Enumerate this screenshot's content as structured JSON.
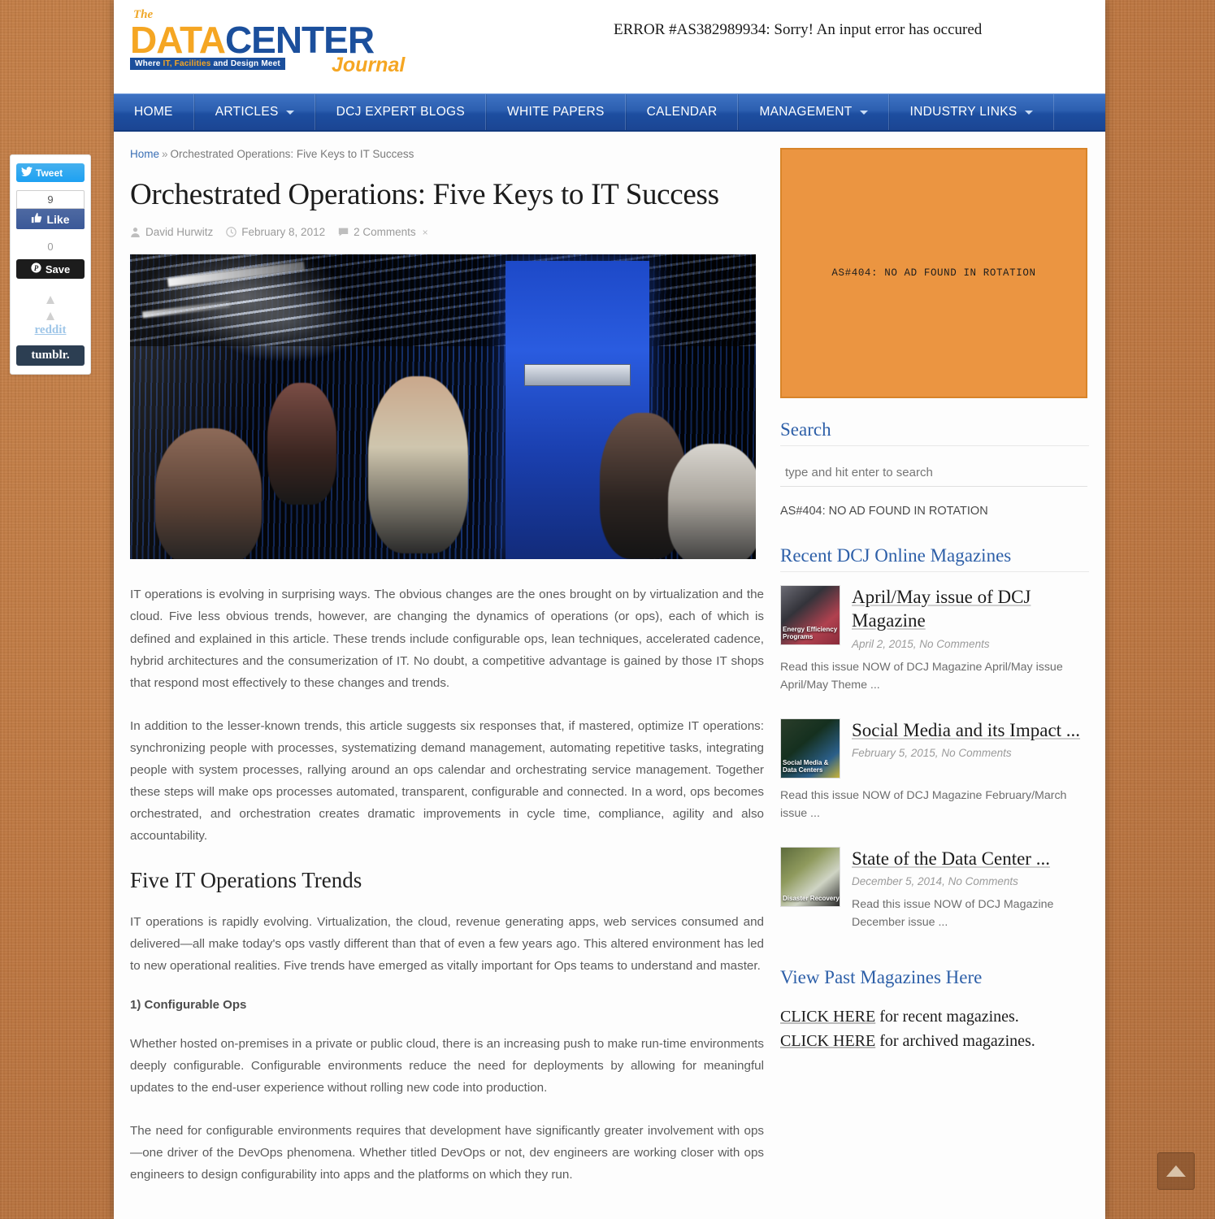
{
  "header": {
    "logo_the": "The",
    "logo_data": "DATA",
    "logo_center": "CENTER",
    "logo_tagline_pre": "Where ",
    "logo_tagline_hl": "IT, Facilities",
    "logo_tagline_post": " and Design Meet",
    "logo_journal": "Journal",
    "error_message": "ERROR #AS382989934: Sorry! An input error has occured"
  },
  "nav": {
    "items": [
      {
        "label": "HOME",
        "caret": false
      },
      {
        "label": "ARTICLES",
        "caret": true
      },
      {
        "label": "DCJ EXPERT BLOGS",
        "caret": false
      },
      {
        "label": "WHITE PAPERS",
        "caret": false
      },
      {
        "label": "CALENDAR",
        "caret": false
      },
      {
        "label": "MANAGEMENT",
        "caret": true
      },
      {
        "label": "INDUSTRY LINKS",
        "caret": true
      }
    ]
  },
  "breadcrumb": {
    "home": "Home",
    "separator": "»",
    "current": "Orchestrated Operations: Five Keys to IT Success"
  },
  "article": {
    "title": "Orchestrated Operations: Five Keys to IT Success",
    "author": "David Hurwitz",
    "date": "February 8, 2012",
    "comments": "2 Comments",
    "comments_close": "×",
    "paragraph_1": "IT operations is evolving in surprising ways. The obvious changes are the ones brought on by virtualization and the cloud. Five less obvious trends, however, are changing the dynamics of operations (or ops), each of which is defined and explained in this article. These trends include configurable ops, lean techniques, accelerated cadence, hybrid architectures and the consumerization of IT. No doubt, a competitive advantage is gained by those IT shops that respond most effectively to these changes and trends.",
    "paragraph_2": "In addition to the lesser-known trends, this article suggests six responses that, if mastered, optimize IT operations: synchronizing people with processes, systematizing demand management, automating repetitive tasks, integrating people with system processes, rallying around an ops calendar and orchestrating service management. Together these steps will make ops processes automated, transparent, configurable and connected. In a word, ops becomes orchestrated, and orchestration creates dramatic improvements in cycle time, compliance, agility and also accountability.",
    "section_heading": "Five IT Operations Trends",
    "paragraph_3": "IT operations is rapidly evolving. Virtualization, the cloud, revenue generating apps, web services consumed and delivered—all make today's ops vastly different than that of even a few years ago. This altered environment has led to new operational realities. Five trends have emerged as vitally important for Ops teams to understand and master.",
    "subheading_1": "1) Configurable Ops",
    "paragraph_4": "Whether hosted on-premises in a private or public cloud, there is an increasing push to make run-time environments deeply configurable. Configurable environments reduce the need for deployments by allowing for meaningful updates to the end-user experience without rolling new code into production.",
    "paragraph_5": "The need for configurable environments requires that development have significantly greater involvement with ops—one driver of the DevOps phenomena. Whether titled DevOps or not, dev engineers are working closer with ops engineers to design configurability into apps and the platforms on which they run."
  },
  "social": {
    "tweet_label": "Tweet",
    "facebook_count": "9",
    "facebook_label": "Like",
    "pinterest_count": "0",
    "pinterest_label": "Save",
    "reddit_label": "reddit",
    "tumblr_label": "tumblr."
  },
  "sidebar": {
    "ad_placeholder_text": "AS#404: NO AD FOUND IN ROTATION",
    "search_title": "Search",
    "search_placeholder": "type and hit enter to search",
    "search_value": "",
    "ad_text_line": "AS#404: NO AD FOUND IN ROTATION",
    "magazines_title": "Recent DCJ Online Magazines",
    "magazines": [
      {
        "title": "April/May issue of DCJ Magazine",
        "date": "April 2, 2015, No Comments",
        "excerpt": "Read this issue NOW of DCJ Magazine April/May issue April/May Theme ...",
        "thumb_caption": "Energy Efficiency Programs"
      },
      {
        "title": "Social Media and its Impact ...",
        "date": "February 5, 2015, No Comments",
        "excerpt": "Read this issue NOW of DCJ Magazine February/March issue    ...",
        "thumb_caption": "Social Media & Data Centers"
      },
      {
        "title": "State of the Data Center ...",
        "date": "December 5, 2014, No Comments",
        "excerpt": "Read this issue NOW of DCJ Magazine December issue      ...",
        "thumb_caption": "Disaster Recovery"
      }
    ],
    "past_title": "View Past Magazines Here",
    "past_line_1_link": "CLICK HERE",
    "past_line_1_rest": " for recent magazines.",
    "past_line_2_link": "CLICK HERE",
    "past_line_2_rest": " for archived magazines."
  },
  "colors": {
    "brand_blue": "#1b4f9c",
    "brand_orange": "#f5a623",
    "nav_blue": "#2c5fb0",
    "ad_orange": "#eb9541",
    "page_background": "#c27c44"
  }
}
